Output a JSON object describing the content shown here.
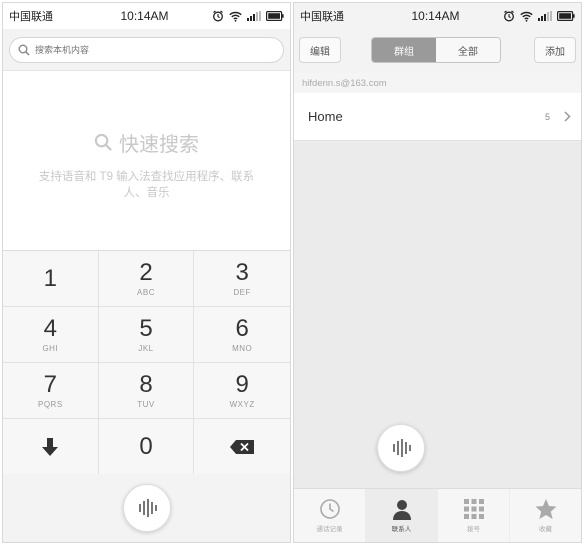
{
  "status_bar": {
    "carrier": "中国联通",
    "time": "10:14AM",
    "icons": [
      "alarm-icon",
      "wifi-icon",
      "signal-icon",
      "battery-icon"
    ]
  },
  "dialer": {
    "search": {
      "placeholder": "搜索本机内容"
    },
    "quick_search": {
      "title": "快速搜索",
      "description": "支持语音和 T9 输入法查找应用程序、联系人、音乐"
    },
    "keys": [
      {
        "digit": "1",
        "letters": ""
      },
      {
        "digit": "2",
        "letters": "ABC"
      },
      {
        "digit": "3",
        "letters": "DEF"
      },
      {
        "digit": "4",
        "letters": "GHI"
      },
      {
        "digit": "5",
        "letters": "JKL"
      },
      {
        "digit": "6",
        "letters": "MNO"
      },
      {
        "digit": "7",
        "letters": "PQRS"
      },
      {
        "digit": "8",
        "letters": "TUV"
      },
      {
        "digit": "9",
        "letters": "WXYZ"
      },
      {
        "digit": "",
        "letters": "",
        "icon": "arrow-down-icon"
      },
      {
        "digit": "0",
        "letters": ""
      },
      {
        "digit": "",
        "letters": "",
        "icon": "backspace-icon"
      }
    ],
    "voice_button_icon": "voice-icon"
  },
  "contacts": {
    "topbar": {
      "edit_label": "编辑",
      "segments": {
        "groups": "群组",
        "all": "全部",
        "active": "groups"
      },
      "add_label": "添加"
    },
    "account": "hifdenn.s@163.com",
    "groups": [
      {
        "name": "Home",
        "count": "5"
      }
    ],
    "voice_button_icon": "voice-icon",
    "tabs": [
      {
        "label": "通话记录",
        "icon": "clock-icon",
        "active": false
      },
      {
        "label": "联系人",
        "icon": "person-icon",
        "active": true
      },
      {
        "label": "拨号",
        "icon": "dialpad-icon",
        "active": false
      },
      {
        "label": "收藏",
        "icon": "star-icon",
        "active": false
      }
    ]
  },
  "colors": {
    "background": "#ffffff",
    "keypad_bg": "#f7f7f7",
    "active_segment": "#9a9a9a",
    "muted_text": "#c8c8c8"
  }
}
